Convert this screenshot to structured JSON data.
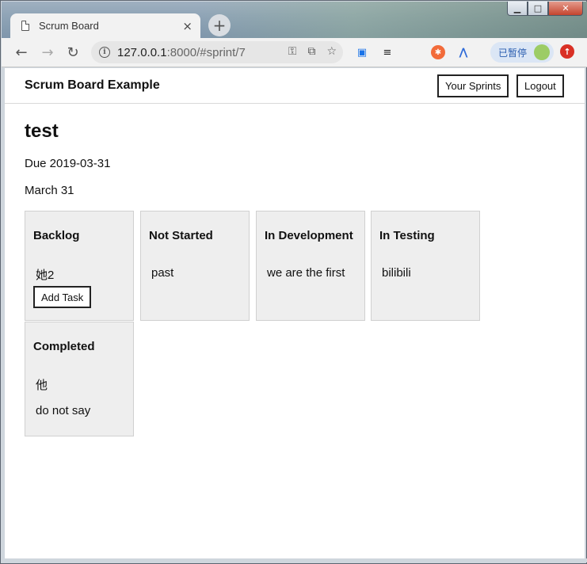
{
  "browser": {
    "tab_title": "Scrum Board",
    "tab_close": "×",
    "new_tab": "+",
    "url_host": "127.0.0.1",
    "url_rest": ":8000/#sprint/7",
    "paused_label": "已暂停",
    "window_min": "▁",
    "window_max": "□",
    "window_close": "✕"
  },
  "app": {
    "brand": "Scrum Board Example",
    "nav": {
      "sprints": "Your Sprints",
      "logout": "Logout"
    }
  },
  "sprint": {
    "name": "test",
    "due": "Due 2019-03-31",
    "end": "March 31"
  },
  "columns": [
    {
      "title": "Backlog",
      "tasks": [
        "她2"
      ],
      "add_label": "Add Task"
    },
    {
      "title": "Not Started",
      "tasks": [
        "past"
      ]
    },
    {
      "title": "In Development",
      "tasks": [
        "we are the first"
      ]
    },
    {
      "title": "In Testing",
      "tasks": [
        "bilibili"
      ]
    },
    {
      "title": "Completed",
      "tasks": [
        "他",
        "do not say"
      ]
    }
  ],
  "colors": {
    "column_bg": "#eeeeee",
    "border": "#222222",
    "paused_text": "#2a5db0",
    "update_badge": "#d93025"
  },
  "icons": [
    "doc-icon",
    "back-icon",
    "forward-icon",
    "reload-icon",
    "info-icon",
    "key-icon",
    "translate-icon",
    "star-icon",
    "cast-icon",
    "menu-lines-icon",
    "extension-icon",
    "vue-icon",
    "avatar",
    "update-icon"
  ]
}
